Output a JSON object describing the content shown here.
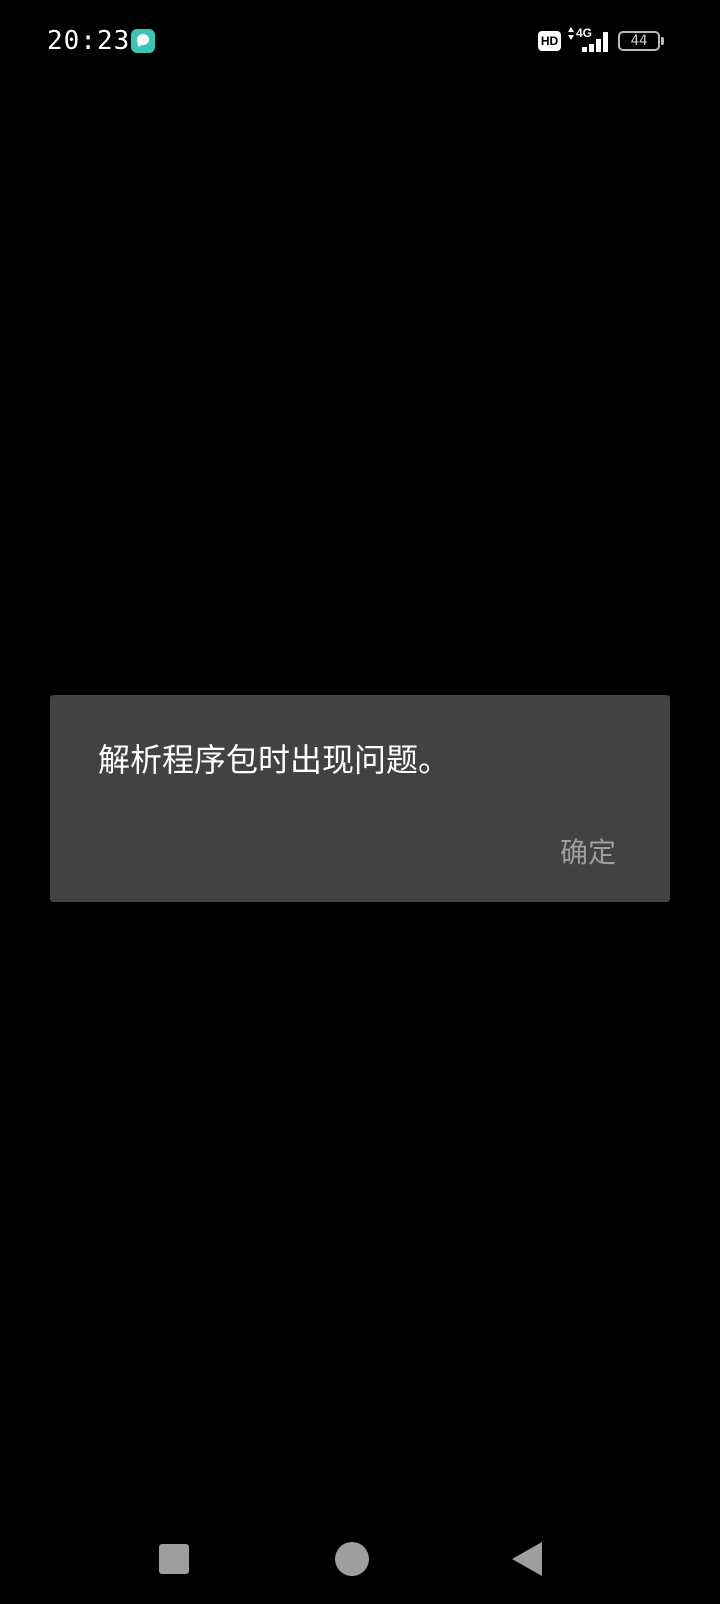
{
  "status_bar": {
    "time": "20:23",
    "notification_icon": "chat-bubble-icon",
    "hd_label": "HD",
    "network_label": "4G",
    "battery_level": "44"
  },
  "dialog": {
    "message": "解析程序包时出现问题。",
    "ok_label": "确定"
  },
  "nav_bar": {
    "recent_icon": "square-recent-apps-icon",
    "home_icon": "circle-home-icon",
    "back_icon": "triangle-back-icon"
  },
  "colors": {
    "background": "#000000",
    "dialog_bg": "#424242",
    "dialog_text": "#ffffff",
    "button_text": "#9e9e9e",
    "nav_icons": "#9e9e9e",
    "notification_accent": "#39c6b4"
  }
}
